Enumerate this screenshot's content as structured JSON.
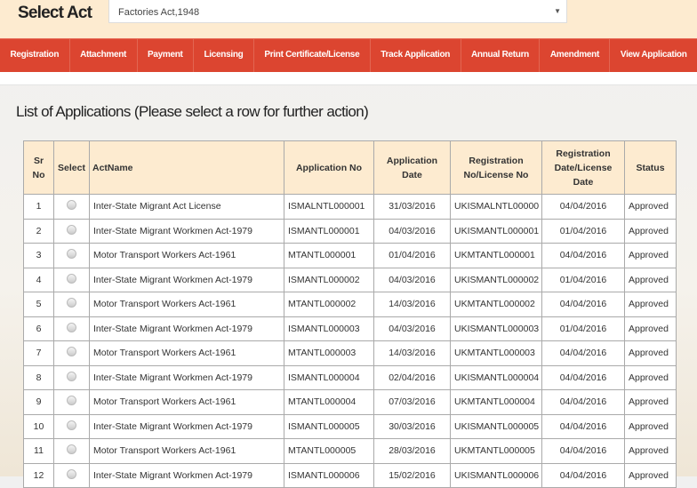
{
  "header": {
    "select_label": "Select Act",
    "selected_act": "Factories Act,1948"
  },
  "nav": [
    "Registration",
    "Attachment",
    "Payment",
    "Licensing",
    "Print Certificate/License",
    "Track Application",
    "Annual Return",
    "Amendment",
    "View Application"
  ],
  "page_title": "List of Applications (Please select a row for further action)",
  "table": {
    "headers": [
      "Sr No",
      "Select",
      "ActName",
      "Application No",
      "Application Date",
      "Registration No/License No",
      "Registration Date/License Date",
      "Status"
    ],
    "rows": [
      [
        "1",
        "Inter-State Migrant Act License",
        "ISMALNTL000001",
        "31/03/2016",
        "UKISMALNTL00000",
        "04/04/2016",
        "Approved"
      ],
      [
        "2",
        "Inter-State Migrant Workmen Act-1979",
        "ISMANTL000001",
        "04/03/2016",
        "UKISMANTL000001",
        "01/04/2016",
        "Approved"
      ],
      [
        "3",
        "Motor Transport Workers Act-1961",
        "MTANTL000001",
        "01/04/2016",
        "UKMTANTL000001",
        "04/04/2016",
        "Approved"
      ],
      [
        "4",
        "Inter-State Migrant Workmen Act-1979",
        "ISMANTL000002",
        "04/03/2016",
        "UKISMANTL000002",
        "01/04/2016",
        "Approved"
      ],
      [
        "5",
        "Motor Transport Workers Act-1961",
        "MTANTL000002",
        "14/03/2016",
        "UKMTANTL000002",
        "04/04/2016",
        "Approved"
      ],
      [
        "6",
        "Inter-State Migrant Workmen Act-1979",
        "ISMANTL000003",
        "04/03/2016",
        "UKISMANTL000003",
        "01/04/2016",
        "Approved"
      ],
      [
        "7",
        "Motor Transport Workers Act-1961",
        "MTANTL000003",
        "14/03/2016",
        "UKMTANTL000003",
        "04/04/2016",
        "Approved"
      ],
      [
        "8",
        "Inter-State Migrant Workmen Act-1979",
        "ISMANTL000004",
        "02/04/2016",
        "UKISMANTL000004",
        "04/04/2016",
        "Approved"
      ],
      [
        "9",
        "Motor Transport Workers Act-1961",
        "MTANTL000004",
        "07/03/2016",
        "UKMTANTL000004",
        "04/04/2016",
        "Approved"
      ],
      [
        "10",
        "Inter-State Migrant Workmen Act-1979",
        "ISMANTL000005",
        "30/03/2016",
        "UKISMANTL000005",
        "04/04/2016",
        "Approved"
      ],
      [
        "11",
        "Motor Transport Workers Act-1961",
        "MTANTL000005",
        "28/03/2016",
        "UKMTANTL000005",
        "04/04/2016",
        "Approved"
      ],
      [
        "12",
        "Inter-State Migrant Workmen Act-1979",
        "ISMANTL000006",
        "15/02/2016",
        "UKISMANTL000006",
        "04/04/2016",
        "Approved"
      ]
    ]
  }
}
